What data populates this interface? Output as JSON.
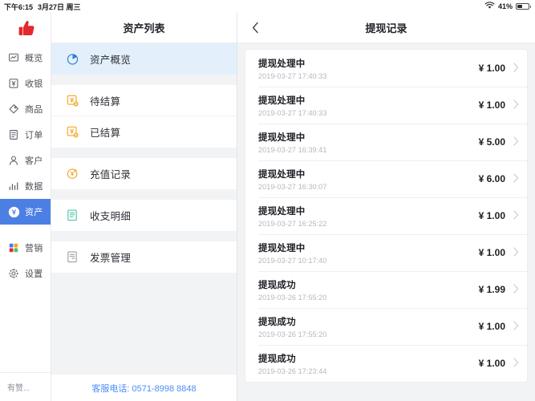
{
  "statusbar": {
    "time": "下午6:15",
    "date": "3月27日 周三",
    "battery_percent": "41%",
    "wifi_icon": "wifi-icon",
    "battery_icon": "battery-icon"
  },
  "rail": {
    "logo_icon": "thumbs-up-logo",
    "items": [
      {
        "label": "概览",
        "icon": "dashboard-icon",
        "active": false
      },
      {
        "label": "收银",
        "icon": "cashier-icon",
        "active": false
      },
      {
        "label": "商品",
        "icon": "tag-icon",
        "active": false
      },
      {
        "label": "订单",
        "icon": "order-list-icon",
        "active": false
      },
      {
        "label": "客户",
        "icon": "user-icon",
        "active": false
      },
      {
        "label": "数据",
        "icon": "bar-chart-icon",
        "active": false
      },
      {
        "label": "资产",
        "icon": "asset-coin-icon",
        "active": true
      },
      {
        "label": "营销",
        "icon": "marketing-grid-icon",
        "active": false
      },
      {
        "label": "设置",
        "icon": "gear-icon",
        "active": false
      }
    ],
    "footer_label": "有赞..."
  },
  "middle": {
    "title": "资产列表",
    "groups": [
      {
        "items": [
          {
            "label": "资产概览",
            "icon": "pie-chart-icon",
            "selected": true
          }
        ]
      },
      {
        "items": [
          {
            "label": "待结算",
            "icon": "yuan-box-pending-icon",
            "selected": false
          },
          {
            "label": "已结算",
            "icon": "yuan-box-settled-icon",
            "selected": false
          }
        ]
      },
      {
        "items": [
          {
            "label": "充值记录",
            "icon": "recharge-circle-icon",
            "selected": false
          }
        ]
      },
      {
        "items": [
          {
            "label": "收支明细",
            "icon": "ledger-icon",
            "selected": false
          }
        ]
      },
      {
        "items": [
          {
            "label": "发票管理",
            "icon": "invoice-icon",
            "selected": false
          }
        ]
      }
    ],
    "footer_label": "客服电话: 0571-8998 8848"
  },
  "detail": {
    "back_icon": "chevron-left-icon",
    "title": "提现记录",
    "chevron_icon": "chevron-right-icon",
    "rows": [
      {
        "status": "提现处理中",
        "time": "2019-03-27 17:40:33",
        "amount": "¥ 1.00"
      },
      {
        "status": "提现处理中",
        "time": "2019-03-27 17:40:33",
        "amount": "¥ 1.00"
      },
      {
        "status": "提现处理中",
        "time": "2019-03-27 16:39:41",
        "amount": "¥ 5.00"
      },
      {
        "status": "提现处理中",
        "time": "2019-03-27 16:30:07",
        "amount": "¥ 6.00"
      },
      {
        "status": "提现处理中",
        "time": "2019-03-27 16:25:22",
        "amount": "¥ 1.00"
      },
      {
        "status": "提现处理中",
        "time": "2019-03-27 10:17:40",
        "amount": "¥ 1.00"
      },
      {
        "status": "提现成功",
        "time": "2019-03-26 17:55:20",
        "amount": "¥ 1.99"
      },
      {
        "status": "提现成功",
        "time": "2019-03-26 17:55:20",
        "amount": "¥ 1.00"
      },
      {
        "status": "提现成功",
        "time": "2019-03-26 17:23:44",
        "amount": "¥ 1.00"
      }
    ]
  },
  "colors": {
    "accent_blue": "#4b7fe3",
    "selected_row": "#e3f0fb",
    "link_blue": "#4c8df6",
    "orange": "#f5a623",
    "teal": "#4cc6a8",
    "logo_red": "#e3292b",
    "page_bg": "#f2f3f5"
  }
}
